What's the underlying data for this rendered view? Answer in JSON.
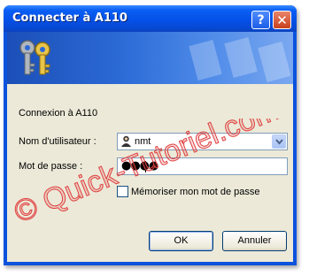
{
  "window": {
    "title": "Connecter à A110"
  },
  "titlebar": {
    "help_label": "?",
    "close_label": "✕"
  },
  "banner": {
    "icon": "keys-icon"
  },
  "dialog": {
    "intro": "Connexion à A110",
    "username_label": "Nom d'utilisateur :",
    "username_value": "nmt",
    "password_label": "Mot de passe :",
    "password_value": "●●●●",
    "remember_label": "Mémoriser mon mot de passe",
    "remember_checked": false
  },
  "buttons": {
    "ok": "OK",
    "cancel": "Annuler"
  },
  "watermark": {
    "text": "© Quick-Tutoriel.com"
  },
  "colors": {
    "titlebar": "#0551e8",
    "client": "#ece9d8",
    "watermark": "#e04040"
  }
}
